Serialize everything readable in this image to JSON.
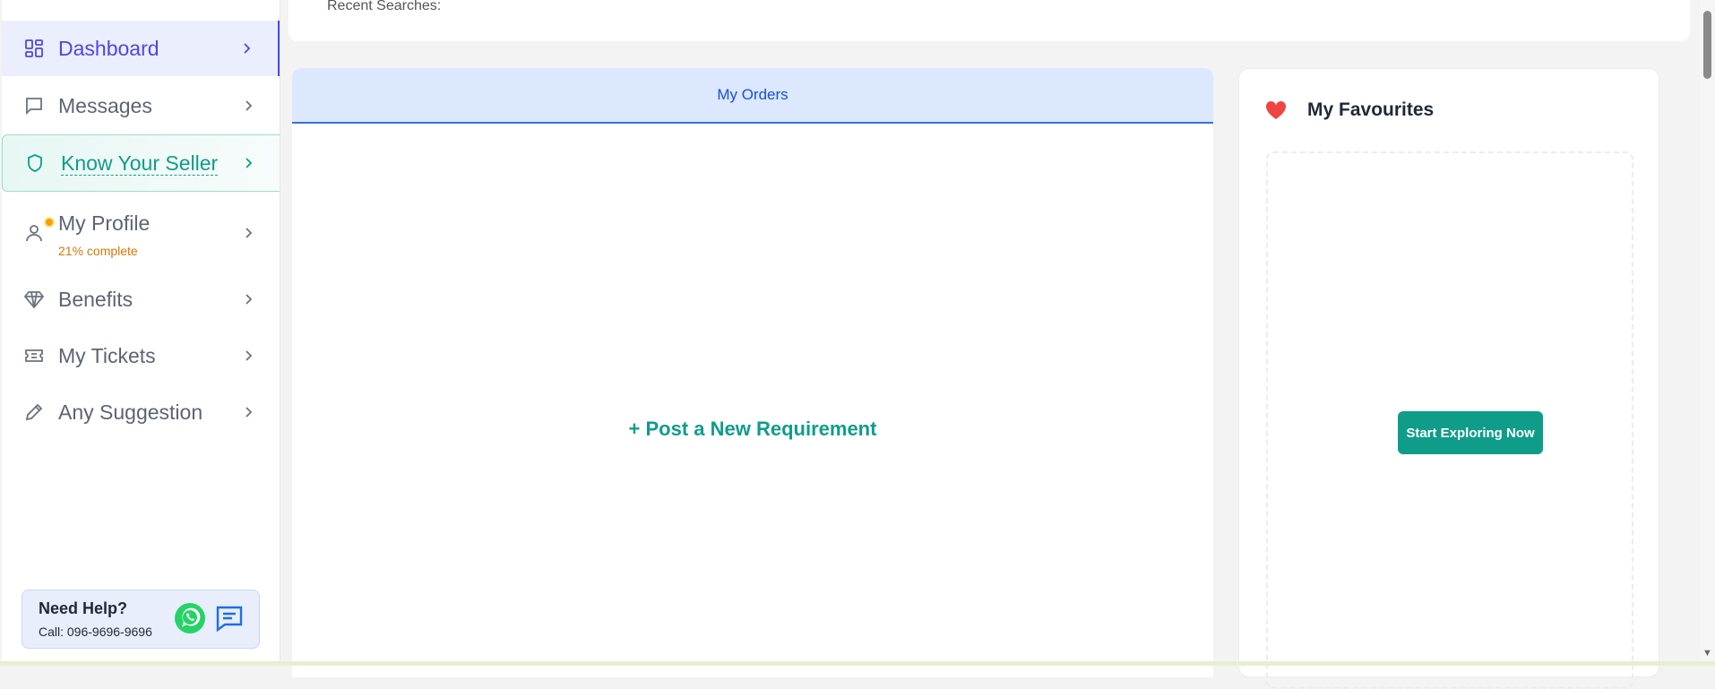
{
  "sidebar": {
    "items": [
      {
        "label": "Dashboard"
      },
      {
        "label": "Messages"
      },
      {
        "label": "Know Your Seller"
      },
      {
        "label": "My Profile",
        "sub": "21% complete"
      },
      {
        "label": "Benefits"
      },
      {
        "label": "My Tickets"
      },
      {
        "label": "Any Suggestion"
      }
    ],
    "help": {
      "title": "Need Help?",
      "phone": "Call: 096-9696-9696"
    }
  },
  "search": {
    "recent_label": "Recent Searches:"
  },
  "orders": {
    "tab_label": "My Orders",
    "post_label": "+ Post a New Requirement"
  },
  "favourites": {
    "title": "My Favourites",
    "button_label": "Start Exploring Now"
  },
  "colors": {
    "accent": "#4f46e5",
    "teal": "#0f9d8a",
    "orange": "#d97706",
    "orders_tab_bg": "#dbe8fd"
  }
}
